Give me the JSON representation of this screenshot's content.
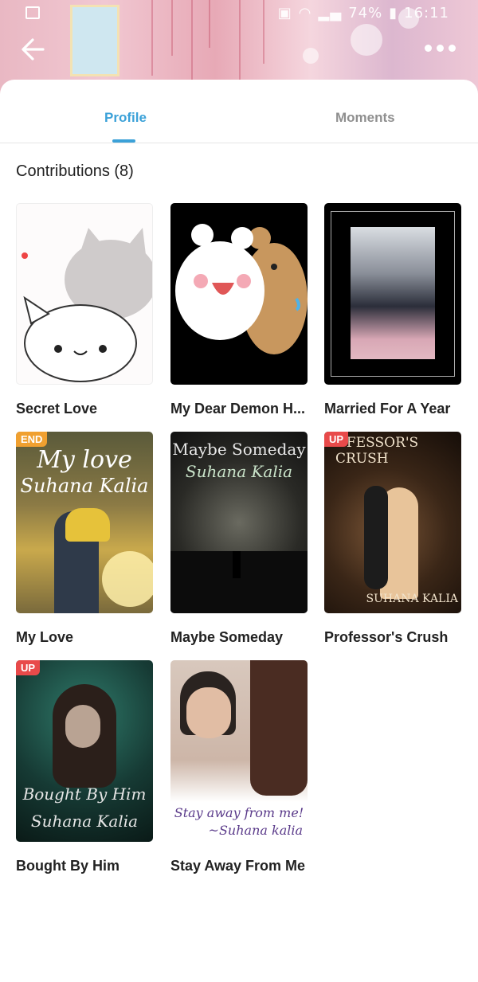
{
  "status": {
    "battery": "74%",
    "time": "16:11"
  },
  "tabs": [
    {
      "label": "Profile",
      "active": true
    },
    {
      "label": "Moments",
      "active": false
    }
  ],
  "contributions": {
    "label": "Contributions (8)"
  },
  "books": [
    {
      "title": "Secret Love",
      "badge": ""
    },
    {
      "title": "My Dear Demon H...",
      "badge": ""
    },
    {
      "title": "Married For A Year",
      "badge": ""
    },
    {
      "title": "My Love",
      "badge": "END",
      "cover_text": [
        "My love",
        "Suhana Kalia"
      ]
    },
    {
      "title": "Maybe Someday",
      "badge": "",
      "cover_text": [
        "Maybe Someday",
        "Suhana Kalia"
      ]
    },
    {
      "title": "Professor's Crush",
      "badge": "UP",
      "cover_text": [
        "OFESSOR'S CRUSH",
        "SUHANA KALIA"
      ]
    },
    {
      "title": "Bought By Him",
      "badge": "UP",
      "cover_text": [
        "Bought By Him",
        "Suhana Kalia"
      ]
    },
    {
      "title": "Stay Away From Me",
      "badge": "",
      "cover_text": [
        "Stay away from me!",
        "~Suhana kalia"
      ]
    }
  ],
  "colors": {
    "accent": "#3ba1d8",
    "badge_end": "#f0a030",
    "badge_up": "#e84a4a"
  }
}
